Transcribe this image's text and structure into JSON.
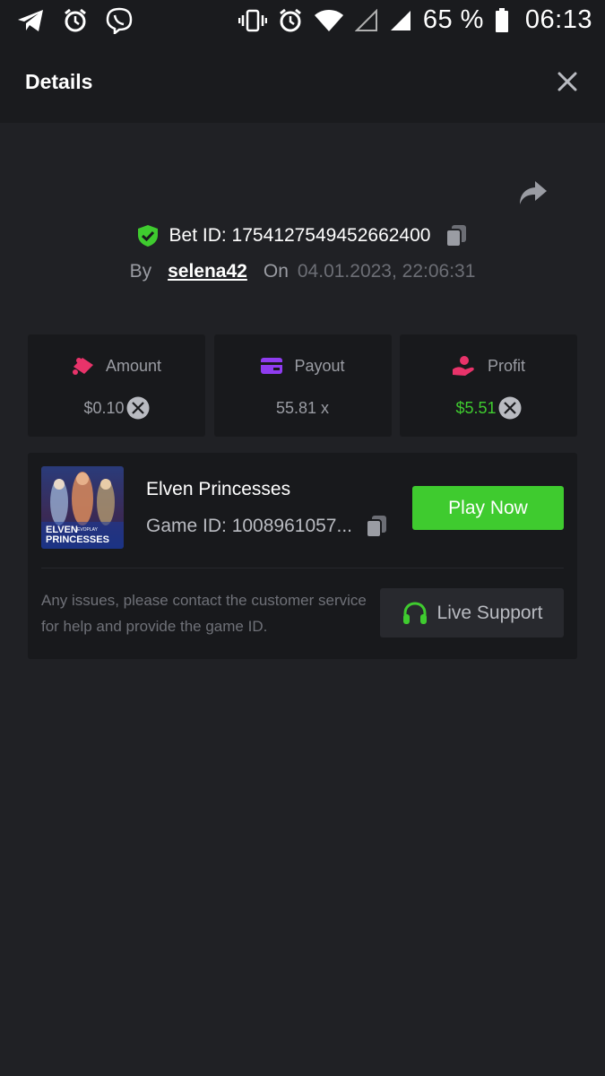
{
  "status_bar": {
    "battery_text": "65 %",
    "clock": "06:13",
    "icons": [
      "telegram-icon",
      "alarm-icon",
      "viber-icon",
      "vibrate-icon",
      "alarm-icon",
      "wifi-icon",
      "signal-empty-icon",
      "signal-icon",
      "battery-icon"
    ]
  },
  "header": {
    "title": "Details",
    "close_icon": "close-icon"
  },
  "bet": {
    "id_text": "Bet ID: 1754127549452662400",
    "by_label": "By",
    "username": "selena42",
    "on_label": "On",
    "datetime": "04.01.2023, 22:06:31"
  },
  "stats": {
    "amount": {
      "label": "Amount",
      "value": "$0.10",
      "icon": "amount-icon"
    },
    "payout": {
      "label": "Payout",
      "value": "55.81 x",
      "icon": "wallet-icon"
    },
    "profit": {
      "label": "Profit",
      "value": "$5.51",
      "icon": "profit-hand-icon"
    }
  },
  "game": {
    "name": "Elven Princesses",
    "id_text": "Game ID: 1008961057...",
    "thumb_title": "ELVEN PRINCESSES",
    "thumb_brand": "EVOPLAY",
    "play_label": "Play Now",
    "notice": "Any issues, please contact the customer service for help and provide the game ID.",
    "support_label": "Live Support"
  },
  "colors": {
    "background": "#202125",
    "header": "#1a1b1e",
    "card": "#18191c",
    "accent_green": "#3fcb2f",
    "muted_text": "#9a9ca3"
  }
}
